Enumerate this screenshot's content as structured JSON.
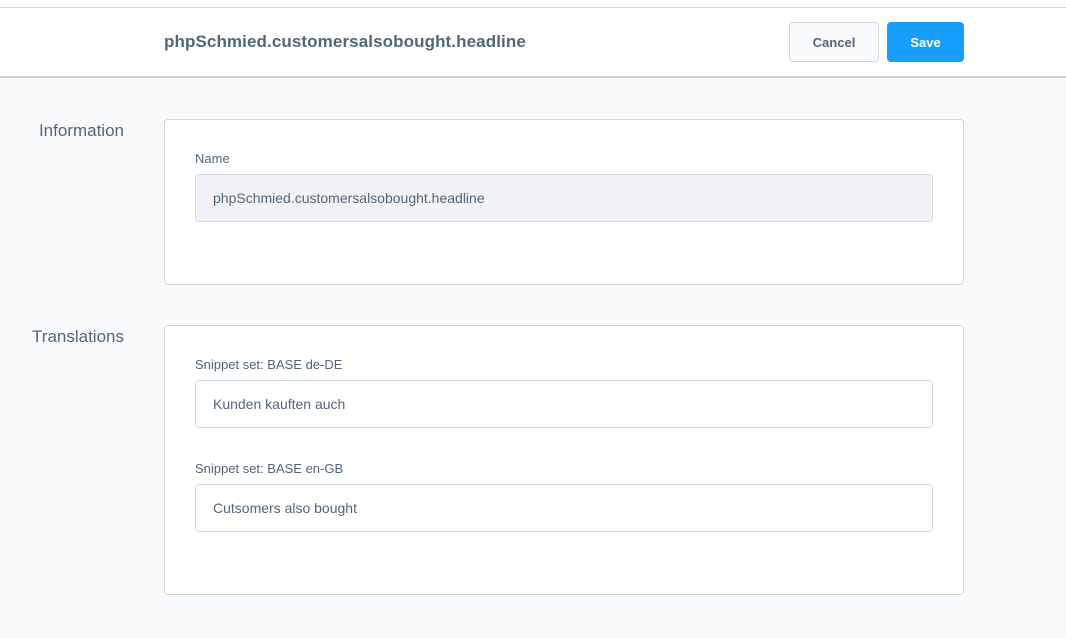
{
  "header": {
    "title": "phpSchmied.customersalsobought.headline",
    "cancel_label": "Cancel",
    "save_label": "Save"
  },
  "information": {
    "section_title": "Information",
    "name_label": "Name",
    "name_value": "phpSchmied.customersalsobought.headline"
  },
  "translations": {
    "section_title": "Translations",
    "fields": [
      {
        "label": "Snippet set: BASE de-DE",
        "value": "Kunden kauften auch"
      },
      {
        "label": "Snippet set: BASE en-GB",
        "value": "Cutsomers also bought"
      }
    ]
  },
  "colors": {
    "primary": "#189eff",
    "text": "#52667a",
    "border": "#d1d9e0",
    "background": "#f9fafb",
    "disabled_input": "#f0f2f5"
  }
}
